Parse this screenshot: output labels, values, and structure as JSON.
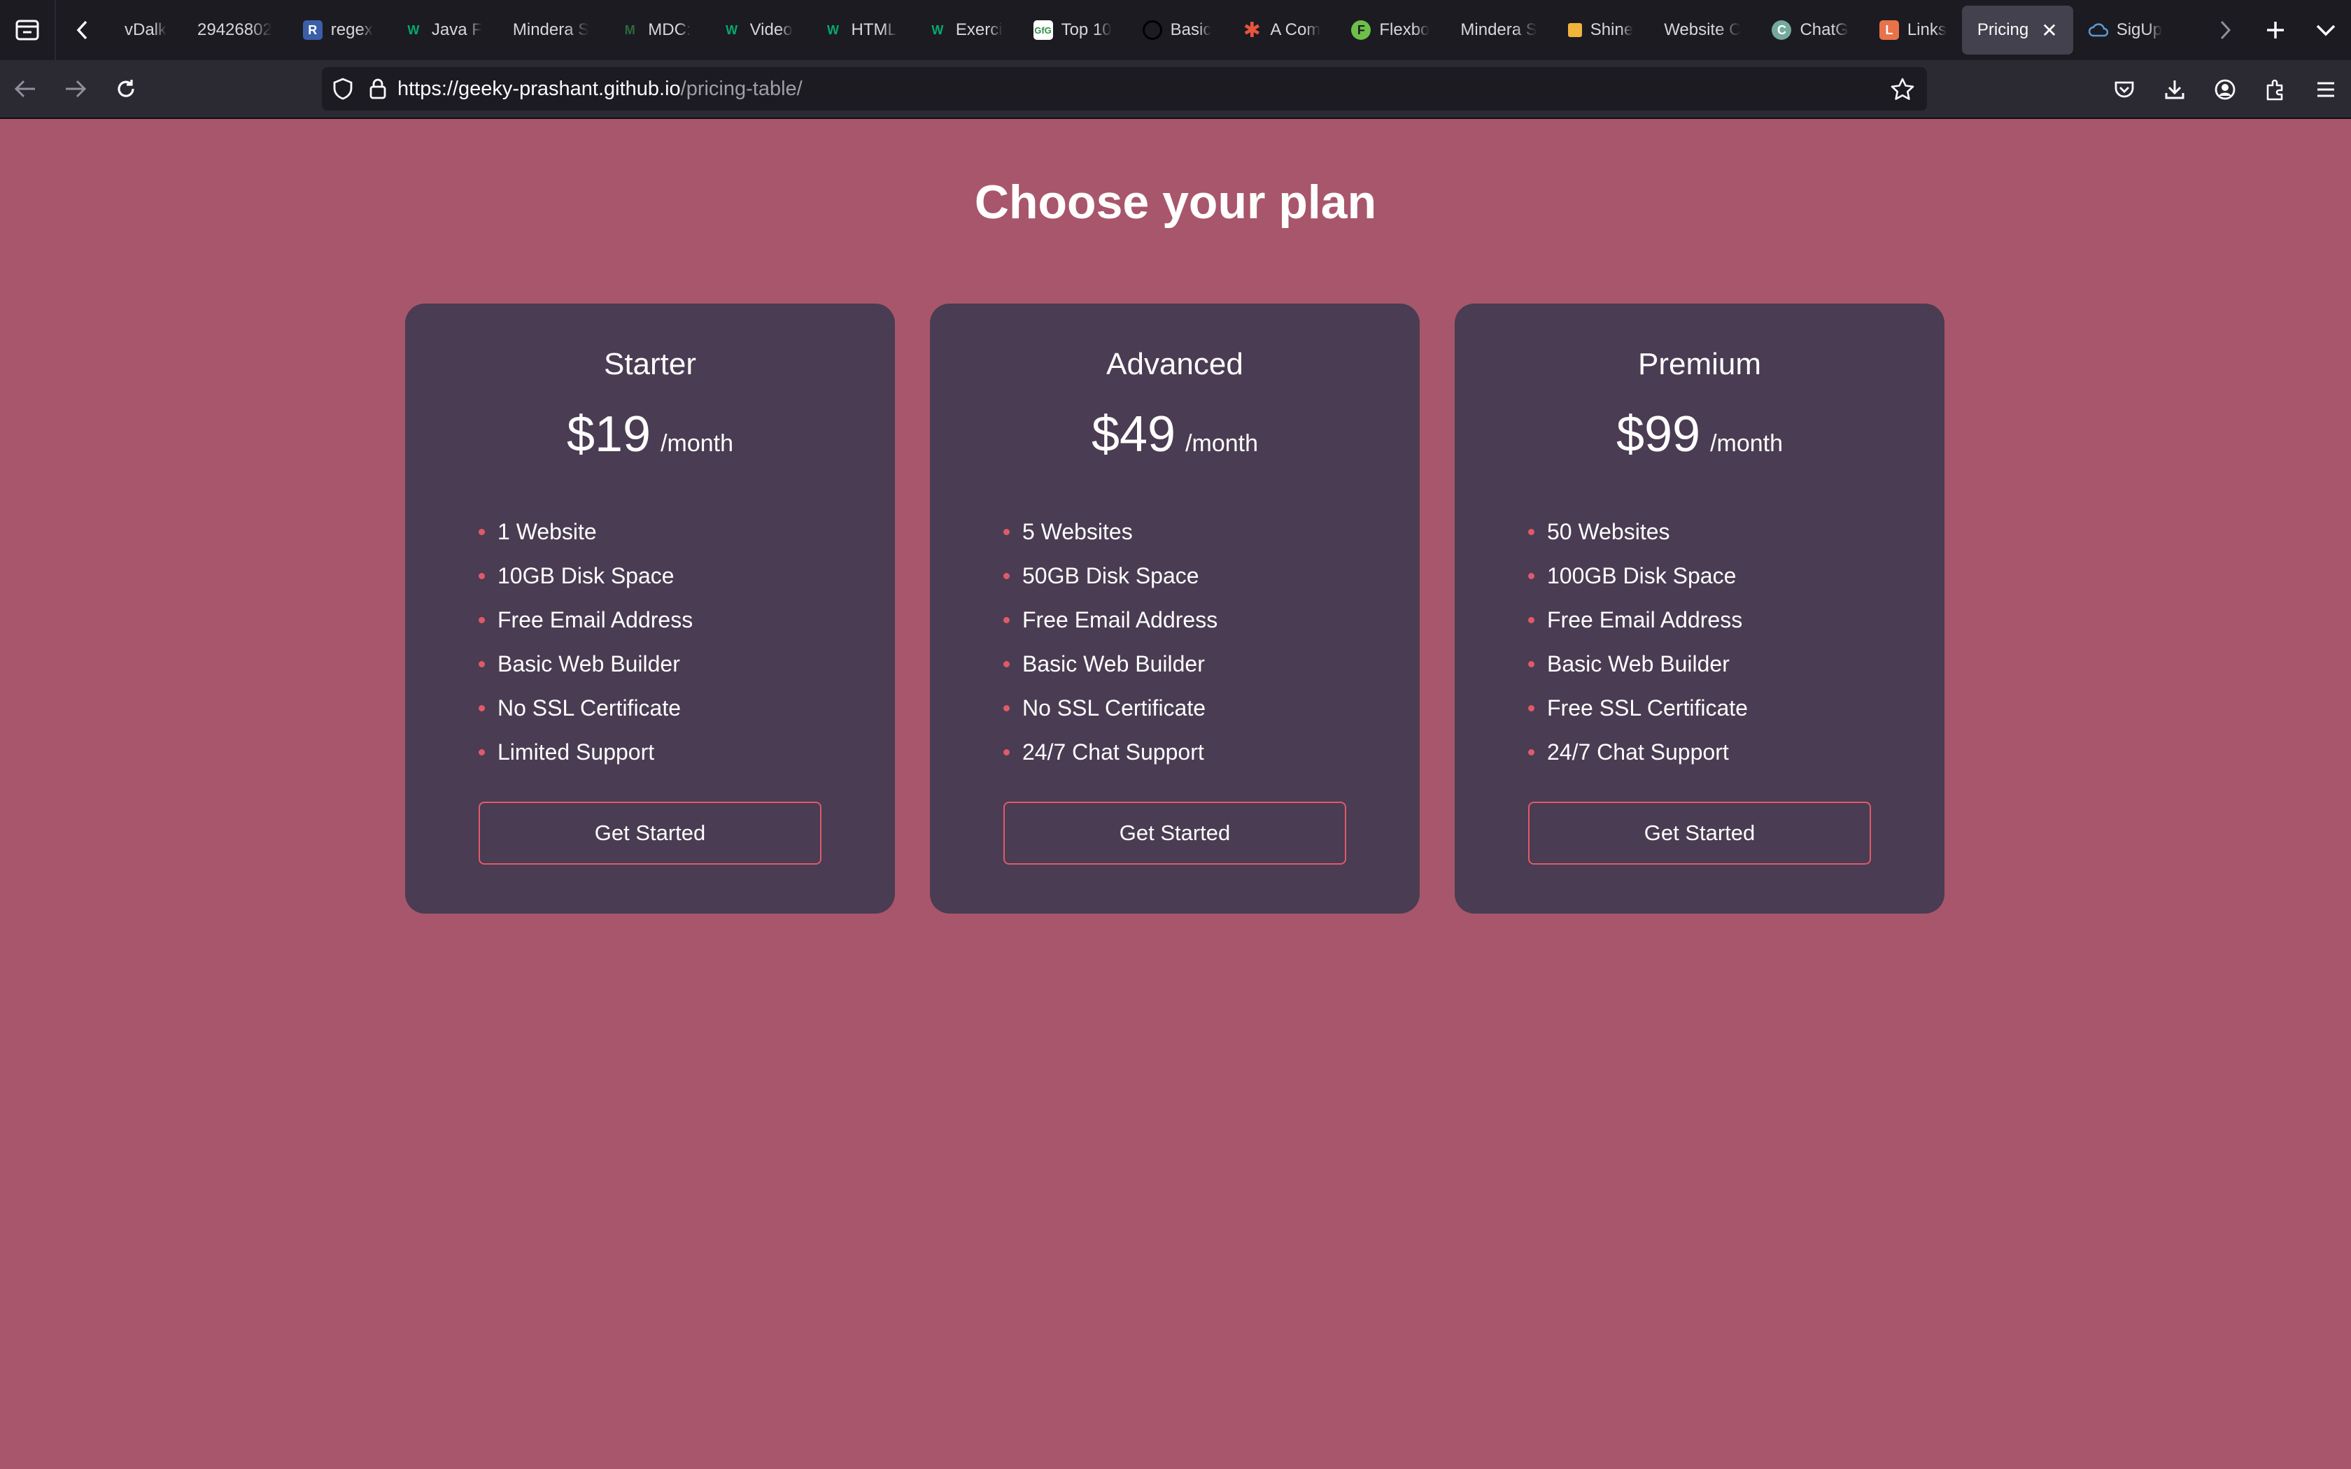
{
  "browser": {
    "tabs": [
      {
        "title": "vDalk",
        "favicon": "none",
        "color": "#1c1b22"
      },
      {
        "title": "29426802",
        "favicon": "none",
        "color": "#1c1b22"
      },
      {
        "title": "regex",
        "favicon": "R",
        "color": "#3b5ea8"
      },
      {
        "title": "Java F",
        "favicon": "W",
        "color": "#04aa6d"
      },
      {
        "title": "Mindera S",
        "favicon": "none",
        "color": "#1c1b22"
      },
      {
        "title": "MDC:",
        "favicon": "M",
        "color": "#2b6a3a"
      },
      {
        "title": "Video",
        "favicon": "W",
        "color": "#04aa6d"
      },
      {
        "title": "HTML",
        "favicon": "W",
        "color": "#04aa6d"
      },
      {
        "title": "Exerci",
        "favicon": "W",
        "color": "#04aa6d"
      },
      {
        "title": "Top 10",
        "favicon": "GfG",
        "color": "#ffffff"
      },
      {
        "title": "Basic",
        "favicon": "O",
        "color": "#000000"
      },
      {
        "title": "A Com",
        "favicon": "*",
        "color": "#e8553e"
      },
      {
        "title": "Flexbo",
        "favicon": "F",
        "color": "#6cc04a"
      },
      {
        "title": "Mindera S",
        "favicon": "none",
        "color": "#1c1b22"
      },
      {
        "title": "Shine",
        "favicon": "S",
        "color": "#f0b43c"
      },
      {
        "title": "Website C",
        "favicon": "none",
        "color": "#1c1b22"
      },
      {
        "title": "ChatG",
        "favicon": "C",
        "color": "#74aa9c"
      },
      {
        "title": "Links",
        "favicon": "L",
        "color": "#e8734a"
      }
    ],
    "active_tab": {
      "title": "Pricing",
      "close": "✕"
    },
    "after_tab": {
      "title": "SigUp",
      "favicon": "cloud",
      "color": "#5b9bd5"
    },
    "url_host": "https://geeky-prashant.github.io",
    "url_path": "/pricing-table/"
  },
  "page": {
    "title": "Choose your plan",
    "plans": [
      {
        "name": "Starter",
        "price": "$19",
        "period": "/month",
        "features": [
          "1 Website",
          "10GB Disk Space",
          "Free Email Address",
          "Basic Web Builder",
          "No SSL Certificate",
          "Limited Support"
        ],
        "button": "Get Started"
      },
      {
        "name": "Advanced",
        "price": "$49",
        "period": "/month",
        "features": [
          "5 Websites",
          "50GB Disk Space",
          "Free Email Address",
          "Basic Web Builder",
          "No SSL Certificate",
          "24/7 Chat Support"
        ],
        "button": "Get Started"
      },
      {
        "name": "Premium",
        "price": "$99",
        "period": "/month",
        "features": [
          "50 Websites",
          "100GB Disk Space",
          "Free Email Address",
          "Basic Web Builder",
          "Free SSL Certificate",
          "24/7 Chat Support"
        ],
        "button": "Get Started"
      }
    ]
  },
  "colors": {
    "page_bg": "#a8566b",
    "card_bg": "#4a3c52",
    "accent": "#e05a68"
  }
}
